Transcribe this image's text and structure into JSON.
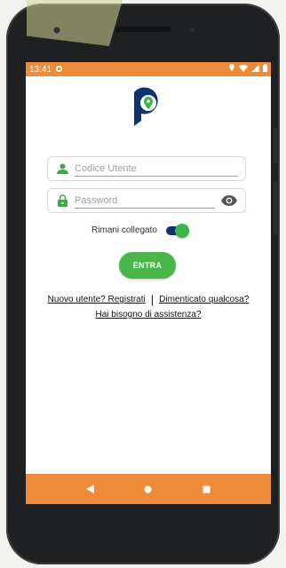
{
  "status_bar": {
    "time": "13:41"
  },
  "login": {
    "user_placeholder": "Codice Utente",
    "password_placeholder": "Password",
    "remember_label": "Rimani collegato",
    "remember_on": true,
    "enter_label": "ENTRA"
  },
  "links": {
    "register": "Nuovo utente? Registrati",
    "separator": "|",
    "forgot": "Dimenticato qualcosa?",
    "help": "Hai bisogno di assistenza?"
  },
  "icons": {
    "user": "user-icon",
    "lock": "lock-icon",
    "eye": "eye-icon",
    "back": "back-nav-icon",
    "home": "home-nav-icon",
    "recents": "recents-nav-icon"
  },
  "colors": {
    "accent_orange": "#ef8a38",
    "accent_green": "#49b64a",
    "brand_blue": "#0d3470"
  }
}
